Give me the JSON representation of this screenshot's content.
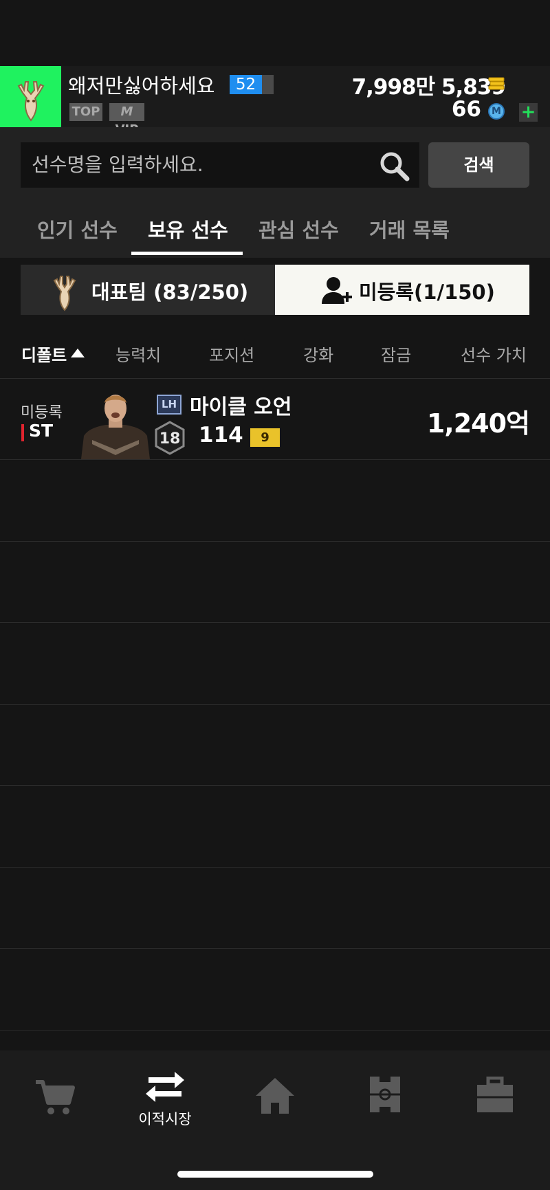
{
  "header": {
    "nickname": "왜저만싫어하세요",
    "level": "52",
    "badges": [
      "TOP",
      "VIP"
    ],
    "badge_vip_prefix": "M",
    "currency_amount": "7,998만 5,839",
    "points_amount": "66",
    "points_icon_letter": "M",
    "add_button": "+"
  },
  "search": {
    "placeholder": "선수명을 입력하세요.",
    "button_label": "검색"
  },
  "tabs": [
    {
      "label": "인기 선수",
      "active": false
    },
    {
      "label": "보유 선수",
      "active": true
    },
    {
      "label": "관심 선수",
      "active": false
    },
    {
      "label": "거래 목록",
      "active": false
    }
  ],
  "team_toggle": {
    "team_label": "대표팀   (83/250)",
    "unregistered_label": "미등록(1/150)"
  },
  "sort_headers": [
    "디폴트",
    "능력치",
    "포지션",
    "강화",
    "잠금",
    "선수 가치"
  ],
  "players": [
    {
      "status": "미등록",
      "position": "ST",
      "season": "LH",
      "name": "마이클 오언",
      "grade": "18",
      "ovr": "114",
      "upgrade": "9",
      "value": "1,240억"
    }
  ],
  "bottom_nav": [
    {
      "icon": "cart-icon",
      "label": ""
    },
    {
      "icon": "transfer-icon",
      "label": "이적시장",
      "active": true
    },
    {
      "icon": "home-icon",
      "label": ""
    },
    {
      "icon": "squad-icon",
      "label": ""
    },
    {
      "icon": "briefcase-icon",
      "label": ""
    }
  ],
  "colors": {
    "background": "#151515",
    "avatar_bg": "#1ff25f",
    "level_blue": "#1f8ef0",
    "position_red": "#e0242e",
    "upgrade_gold": "#e9c22a",
    "plus_green": "#22e05a"
  }
}
